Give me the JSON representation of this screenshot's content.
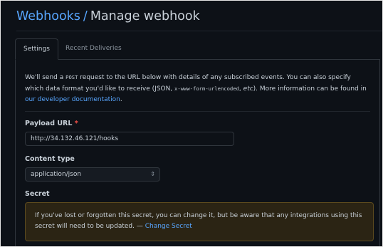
{
  "header": {
    "breadcrumb_link": "Webhooks",
    "separator": "/",
    "page_title": "Manage webhook"
  },
  "tabs": [
    {
      "label": "Settings",
      "active": true
    },
    {
      "label": "Recent Deliveries",
      "active": false
    }
  ],
  "intro": {
    "part1": "We'll send a ",
    "code1": "POST",
    "part2": " request to the URL below with details of any subscribed events. You can also specify which data format you'd like to receive (JSON, ",
    "code2": "x-www-form-urlencoded",
    "part3": ", ",
    "etc": "etc",
    "part4": "). More information can be found in ",
    "link": "our developer documentation",
    "part5": "."
  },
  "payload_url": {
    "label": "Payload URL",
    "required_mark": "*",
    "value": "http://34.132.46.121/hooks"
  },
  "content_type": {
    "label": "Content type",
    "selected": "application/json",
    "arrow": "⇕"
  },
  "secret": {
    "label": "Secret",
    "notice_text": "If you've lost or forgotten this secret, you can change it, but be aware that any integrations using this secret will need to be updated. — ",
    "change_link": "Change Secret"
  },
  "colors": {
    "background": "#0d1117",
    "link": "#58a6ff",
    "required": "#f85149",
    "warning_bg": "#2b2414",
    "warning_border": "#5c4a1e"
  }
}
